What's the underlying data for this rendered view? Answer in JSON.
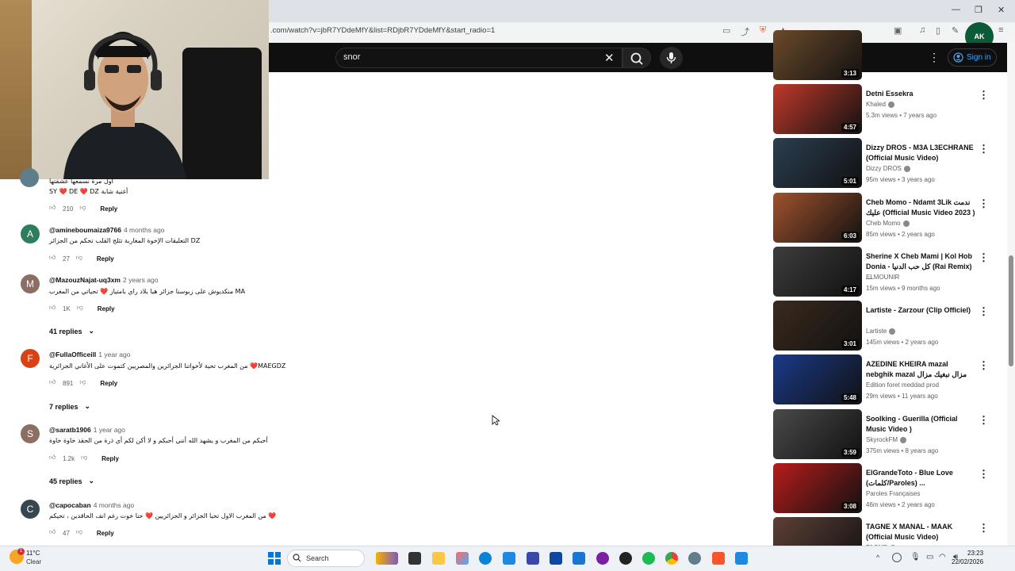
{
  "browser": {
    "url": ".com/watch?v=jbR7YDdeMfY&list=RDjbR7YDdeMfY&start_radio=1"
  },
  "youtube": {
    "search_value": "snor",
    "sign_in_label": "Sign in"
  },
  "comments": [
    {
      "text_line1": "أول مرة نسمعها عشقتها",
      "text_line2": "SY ❤️ DE ❤️ DZ أغنية شابة",
      "likes": "210",
      "reply_label": "Reply"
    },
    {
      "avatar_letter": "A",
      "avatar_color": "#2e7d5b",
      "username": "@amineboumaiza9766",
      "time": "4 months ago",
      "text": "التعليقات الإخوة المغاربة تثلج القلب تحكم من الجزائر DZ",
      "likes": "27",
      "reply_label": "Reply"
    },
    {
      "avatar_letter": "M",
      "avatar_color": "#8d6e63",
      "username": "@MazouzNajat-uq3xm",
      "time": "2 years ago",
      "text": "منكديوش على زبوسنا جزائر هيا بلاد راي بامتياز ❤️ تحياتي من المغرب MA",
      "likes": "1K",
      "reply_label": "Reply",
      "replies_label": "41 replies"
    },
    {
      "avatar_letter": "F",
      "avatar_color": "#d84315",
      "username": "@FullaOfficeill",
      "time": "1 year ago",
      "text": "من المغرب تحية لأخواتنا الجزائرين والمصريين كتموت على الأغاني الجزائرية ❤️MAEGDZ",
      "likes": "891",
      "reply_label": "Reply",
      "replies_label": "7 replies"
    },
    {
      "avatar_letter": "S",
      "avatar_color": "#8d6e63",
      "username": "@saratb1906",
      "time": "1 year ago",
      "text": "أحبكم من المغرب و يشهد الله أنني أحبكم و لا أكن لكم أي ذرة من الحقد خاوة خاوة",
      "likes": "1.2k",
      "reply_label": "Reply",
      "replies_label": "45 replies"
    },
    {
      "avatar_letter": "C",
      "avatar_color": "#37474f",
      "username": "@capocaban",
      "time": "4 months ago",
      "text": "من المغرب الاول تحيا الجزائر و الجزائريين ❤️ حنا خوت رغم انف الحاقدين ، تحيكم ❤️",
      "likes": "47",
      "reply_label": "Reply"
    }
  ],
  "videos": [
    {
      "duration": "3:13",
      "title": "",
      "channel": "",
      "meta": "",
      "thumb_color": "#6b4a2a"
    },
    {
      "duration": "4:57",
      "title": "Detni Essekra",
      "channel": "Khaled",
      "verified": true,
      "meta": "5.3m views • 7 years ago",
      "thumb_color": "#c0392b"
    },
    {
      "duration": "5:01",
      "title": "Dizzy DROS - M3A L3ECHRANE (Official Music Video)",
      "channel": "Dizzy DROS",
      "verified": true,
      "meta": "95m views • 3 years ago",
      "thumb_color": "#2c3e50"
    },
    {
      "duration": "6:03",
      "title": "Cheb Momo - Ndamt 3Lik ندمت عليك (Official Music Video 2023 )",
      "channel": "Cheb Momo",
      "verified": true,
      "meta": "85m views • 2 years ago",
      "thumb_color": "#a0522d"
    },
    {
      "duration": "4:17",
      "title": "Sherine X Cheb Mami | Kol Hob Donia - كل حب الدنيا (Rai Remix) ...",
      "channel": "ELMOUNIR",
      "verified": false,
      "meta": "15m views • 9 months ago",
      "thumb_color": "#3d3d3d"
    },
    {
      "duration": "3:01",
      "title": "Lartiste - Zarzour (Clip Officiel)",
      "channel": "Lartiste",
      "verified": true,
      "meta": "145m views • 2 years ago",
      "thumb_color": "#3b2a1e"
    },
    {
      "duration": "5:48",
      "title": "AZEDINE KHEIRA mazal nebghik mazal مزال نبغيك مزال",
      "channel": "Edition foret meddad prod",
      "verified": false,
      "meta": "29m views • 11 years ago",
      "thumb_color": "#1a3a8a"
    },
    {
      "duration": "3:59",
      "title": "Soolking - Guerilla (Official Music Video )",
      "channel": "SkyrockFM",
      "verified": true,
      "meta": "375m views • 8 years ago",
      "thumb_color": "#4a4a4a"
    },
    {
      "duration": "3:08",
      "title": "ElGrandeToto - Blue Love (كلمات/Paroles) ...",
      "channel": "Paroles Françaises",
      "verified": false,
      "meta": "46m views • 2 years ago",
      "thumb_color": "#b71c1c"
    },
    {
      "duration": "",
      "title": "TAGNE X MANAL - MAAK (Official Music Video)",
      "channel": "TAGNE",
      "verified": true,
      "meta": "",
      "thumb_color": "#5d4037"
    }
  ],
  "taskbar": {
    "weather_temp": "11°C",
    "weather_cond": "Clear",
    "search_label": "Search",
    "time": "23:23",
    "date": "22/02/2026"
  }
}
